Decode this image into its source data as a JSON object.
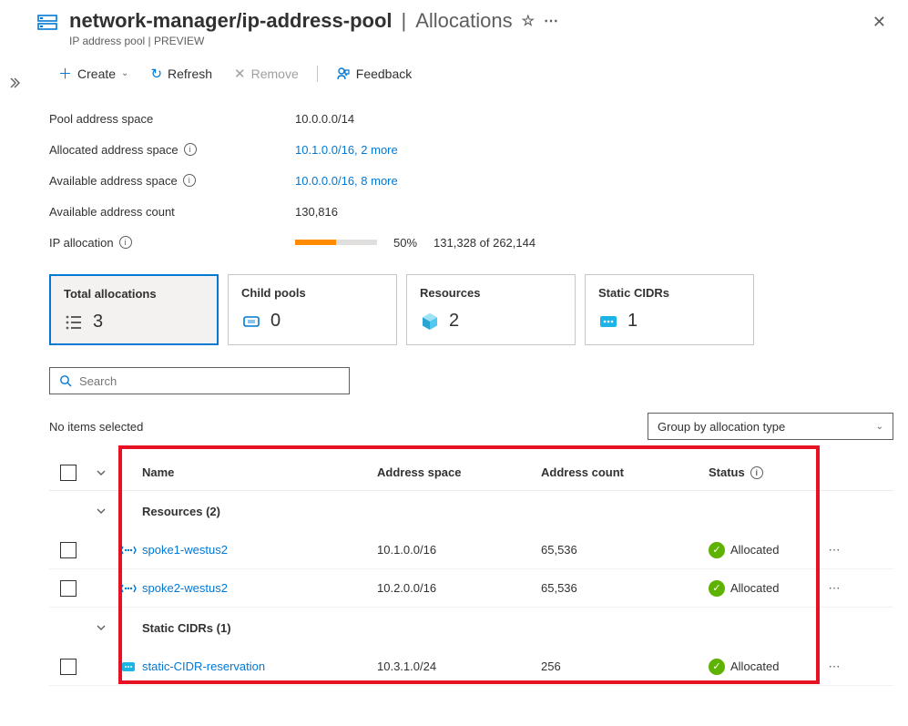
{
  "header": {
    "path": "network-manager/ip-address-pool",
    "section": "Allocations",
    "subtitle": "IP address pool | PREVIEW"
  },
  "toolbar": {
    "create": "Create",
    "refresh": "Refresh",
    "remove": "Remove",
    "feedback": "Feedback"
  },
  "props": {
    "pool_address_space": {
      "label": "Pool address space",
      "value": "10.0.0.0/14"
    },
    "allocated_address_space": {
      "label": "Allocated address space",
      "value": "10.1.0.0/16, 2 more"
    },
    "available_address_space": {
      "label": "Available address space",
      "value": "10.0.0.0/16, 8 more"
    },
    "available_address_count": {
      "label": "Available address count",
      "value": "130,816"
    },
    "ip_allocation": {
      "label": "IP allocation",
      "percent": "50%",
      "of_text": "131,328 of 262,144",
      "fill_pct": 50
    }
  },
  "cards": {
    "total": {
      "title": "Total allocations",
      "count": "3"
    },
    "child": {
      "title": "Child pools",
      "count": "0"
    },
    "resources": {
      "title": "Resources",
      "count": "2"
    },
    "static": {
      "title": "Static CIDRs",
      "count": "1"
    }
  },
  "search": {
    "placeholder": "Search"
  },
  "selection_text": "No items selected",
  "group_by": {
    "value": "Group by allocation type"
  },
  "columns": {
    "name": "Name",
    "address_space": "Address space",
    "address_count": "Address count",
    "status": "Status"
  },
  "groups": {
    "resources": {
      "label": "Resources (2)",
      "items": [
        {
          "name": "spoke1-westus2",
          "addr": "10.1.0.0/16",
          "count": "65,536",
          "status": "Allocated"
        },
        {
          "name": "spoke2-westus2",
          "addr": "10.2.0.0/16",
          "count": "65,536",
          "status": "Allocated"
        }
      ]
    },
    "static": {
      "label": "Static CIDRs (1)",
      "items": [
        {
          "name": "static-CIDR-reservation",
          "addr": "10.3.1.0/24",
          "count": "256",
          "status": "Allocated"
        }
      ]
    }
  }
}
